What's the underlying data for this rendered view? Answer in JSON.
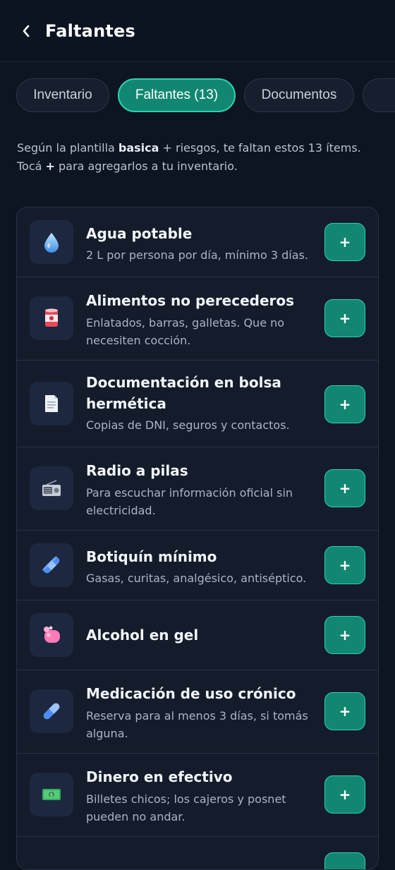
{
  "header": {
    "title": "Faltantes"
  },
  "tabs": [
    {
      "label": "Inventario"
    },
    {
      "label": "Faltantes (13)"
    },
    {
      "label": "Documentos"
    }
  ],
  "intro": {
    "line1_pre": "Según la plantilla ",
    "template_name": "basica",
    "line1_post": " + riesgos, te faltan estos 13 ítems.",
    "line2_pre": "Tocá ",
    "plus": "+",
    "line2_post": " para agregarlos a tu inventario."
  },
  "items": [
    {
      "title": "Agua potable",
      "desc1": "2 L por persona por día, mínimo 3 días.",
      "desc2": "",
      "icon": "water-drop-icon",
      "add_label": "+"
    },
    {
      "title": "Alimentos no perecederos",
      "desc1": "Enlatados, barras, galletas. Que no",
      "desc2": "necesiten cocción.",
      "icon": "canned-food-icon",
      "add_label": "+"
    },
    {
      "title": "Documentación en bolsa",
      "title2": "hermética",
      "desc1": "Copias de DNI, seguros y contactos.",
      "desc2": "",
      "icon": "document-icon",
      "add_label": "+"
    },
    {
      "title": "Radio a pilas",
      "desc1": "Para escuchar información oficial sin",
      "desc2": "electricidad.",
      "icon": "radio-icon",
      "add_label": "+"
    },
    {
      "title": "Botiquín mínimo",
      "desc1": "Gasas, curitas, analgésico, antiséptico.",
      "desc2": "",
      "icon": "bandage-icon",
      "add_label": "+"
    },
    {
      "title": "Alcohol en gel",
      "desc1": "",
      "desc2": "",
      "icon": "soap-icon",
      "add_label": "+"
    },
    {
      "title": "Medicación de uso crónico",
      "desc1": "Reserva para al menos 3 días, si tomás",
      "desc2": "alguna.",
      "icon": "pill-icon",
      "add_label": "+"
    },
    {
      "title": "Dinero en efectivo",
      "desc1": "Billetes chicos; los cajeros y posnet",
      "desc2": "pueden no andar.",
      "icon": "cash-icon",
      "add_label": "+"
    }
  ],
  "colors": {
    "accent": "#118772",
    "accent_border": "#2fd1ad",
    "background": "#0d1422",
    "card": "#141c2b"
  }
}
